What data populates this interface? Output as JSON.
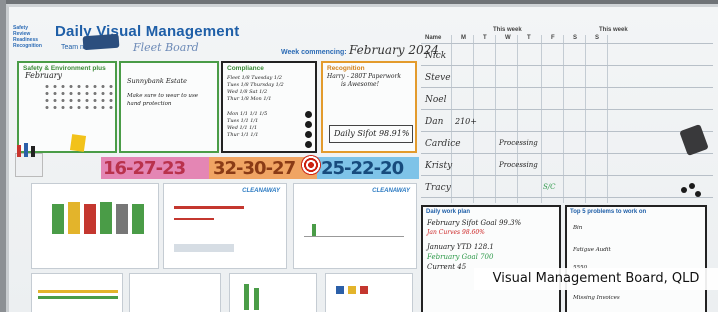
{
  "board": {
    "header_left": [
      "Safety",
      "Review",
      "Readiness",
      "Recognition"
    ],
    "title": "Daily Visual Management",
    "team_label": "Team name:",
    "team_value": "Fleet Board",
    "week_label": "Week commencing:",
    "week_value": "February 2024"
  },
  "panels": {
    "safety_title": "Safety & Environment plus",
    "safety_month": "February",
    "second_line1": "Sunnybank Estate",
    "second_line2": "Make sure to wear to use",
    "second_line3": "hand protection",
    "compliance_title": "Compliance",
    "compliance_lines": [
      "Fleet 1/8  Tuesday 1/2",
      "Tues 1/8  Thursday 1/2",
      "Wed 1/8  Sat 1/2",
      "Thur 1/8  Mon 1/1"
    ],
    "compliance_lines2": [
      "Mon 1/1  1/1  1/5",
      "Tues 1/1  1/1",
      "Wed 1/1  1/1",
      "Thur 1/1  1/1"
    ],
    "recognition_title": "Recognition",
    "recognition_text1": "Harry - 280T Paperwork",
    "recognition_text2": "is Awesome!",
    "daily_sifot": "Daily Sifot 98.91%"
  },
  "strip": {
    "n1": "16-27-23",
    "n2": "32-30-27",
    "n3": "25-22-20"
  },
  "sheets": {
    "logo": "CLEANAWAY"
  },
  "schedule": {
    "name_header": "Name",
    "this_week_label": "This week",
    "this_week_label2": "This week",
    "days": [
      "M",
      "T",
      "W",
      "T",
      "F",
      "S",
      "S"
    ],
    "names": [
      "Nick",
      "Steve",
      "Noel",
      "Dan",
      "Cardice",
      "Kristy",
      "Tracy"
    ],
    "entries": [
      {
        "row": 3,
        "col": 0,
        "text": "210+"
      },
      {
        "row": 4,
        "col": 0,
        "text": "Processing"
      },
      {
        "row": 5,
        "col": 0,
        "text": "Processing"
      },
      {
        "row": 6,
        "col": 1,
        "text": "S/C"
      }
    ]
  },
  "daily_work_plan": {
    "title": "Daily work plan",
    "line1": "February Sifot Goal 99.3%",
    "line2": "Jan Curves  98.60%",
    "line3": "January YTD  128.1",
    "line4": "February Goal 700",
    "line5": "Current  45"
  },
  "top5": {
    "title": "Top 5 problems to work on",
    "items": [
      "Bin",
      "Fatigue Audit",
      "5550",
      "Missing Invoices"
    ]
  },
  "caption": "Visual Management Board, QLD",
  "colors": {
    "brand_blue": "#1f5fa8",
    "green_border": "#4a9c47",
    "orange_border": "#e39b2d"
  }
}
